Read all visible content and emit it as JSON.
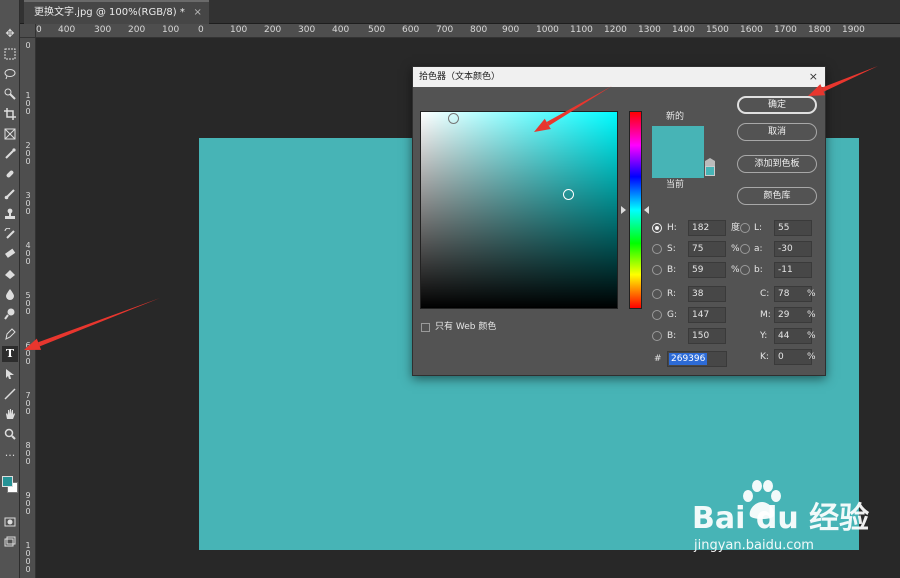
{
  "document_tab": {
    "title": "更换文字.jpg @ 100%(RGB/8) *",
    "close_glyph": "×"
  },
  "rulers": {
    "horizontal": [
      "0",
      "400",
      "300",
      "200",
      "100",
      "0",
      "100",
      "200",
      "300",
      "400",
      "500",
      "600",
      "700",
      "800",
      "900",
      "1000",
      "1100",
      "1200",
      "1300",
      "1400",
      "1500",
      "1600",
      "1700",
      "1800",
      "1900"
    ],
    "vertical": [
      "0",
      "100",
      "200",
      "300",
      "400",
      "500",
      "600",
      "700",
      "800",
      "900",
      "1000"
    ]
  },
  "toolbar": {
    "tools": [
      "move-tool",
      "marquee-tool",
      "lasso-tool",
      "quick-selection-tool",
      "crop-tool",
      "frame-tool",
      "eyedropper-tool",
      "healing-brush-tool",
      "brush-tool",
      "clone-stamp-tool",
      "history-brush-tool",
      "eraser-tool",
      "gradient-tool",
      "blur-tool",
      "dodge-tool",
      "pen-tool",
      "type-tool",
      "path-selection-tool",
      "line-tool",
      "hand-tool",
      "zoom-tool",
      "more-tools",
      "foreground-background-colors",
      "quick-mask-mode",
      "screen-mode"
    ],
    "active": "type-tool",
    "type_tool_glyph": "T",
    "foreground_color": "#269396",
    "background_color": "#ffffff"
  },
  "canvas": {
    "fill_color": "#47b4b6"
  },
  "color_picker": {
    "title": "拾色器（文本颜色）",
    "close_glyph": "×",
    "new_label": "新的",
    "current_label": "当前",
    "new_color": "#47b4b6",
    "current_color": "#47b4b6",
    "buttons": {
      "ok": "确定",
      "cancel": "取消",
      "add_to_swatches": "添加到色板",
      "color_libraries": "颜色库"
    },
    "hsb": {
      "h_label": "H:",
      "h_value": "182",
      "h_unit": "度",
      "s_label": "S:",
      "s_value": "75",
      "s_unit": "%",
      "b_label": "B:",
      "b_value": "59",
      "b_unit": "%"
    },
    "rgb": {
      "r_label": "R:",
      "r_value": "38",
      "g_label": "G:",
      "g_value": "147",
      "b_label": "B:",
      "b_value": "150"
    },
    "lab": {
      "l_label": "L:",
      "l_value": "55",
      "a_label": "a:",
      "a_value": "-30",
      "b_label": "b:",
      "b_value": "-11"
    },
    "cmyk": {
      "c_label": "C:",
      "c_value": "78",
      "c_unit": "%",
      "m_label": "M:",
      "m_value": "29",
      "m_unit": "%",
      "y_label": "Y:",
      "y_value": "44",
      "y_unit": "%",
      "k_label": "K:",
      "k_value": "0",
      "k_unit": "%"
    },
    "hex_label": "#",
    "hex_value": "269396",
    "web_only_label": "只有 Web 颜色",
    "web_only_checked": false,
    "selected_mode": "H"
  },
  "annotations": {
    "arrow_color": "#e8362e"
  },
  "watermark": {
    "logo": "Bai du 经验",
    "url": "jingyan.baidu.com"
  }
}
